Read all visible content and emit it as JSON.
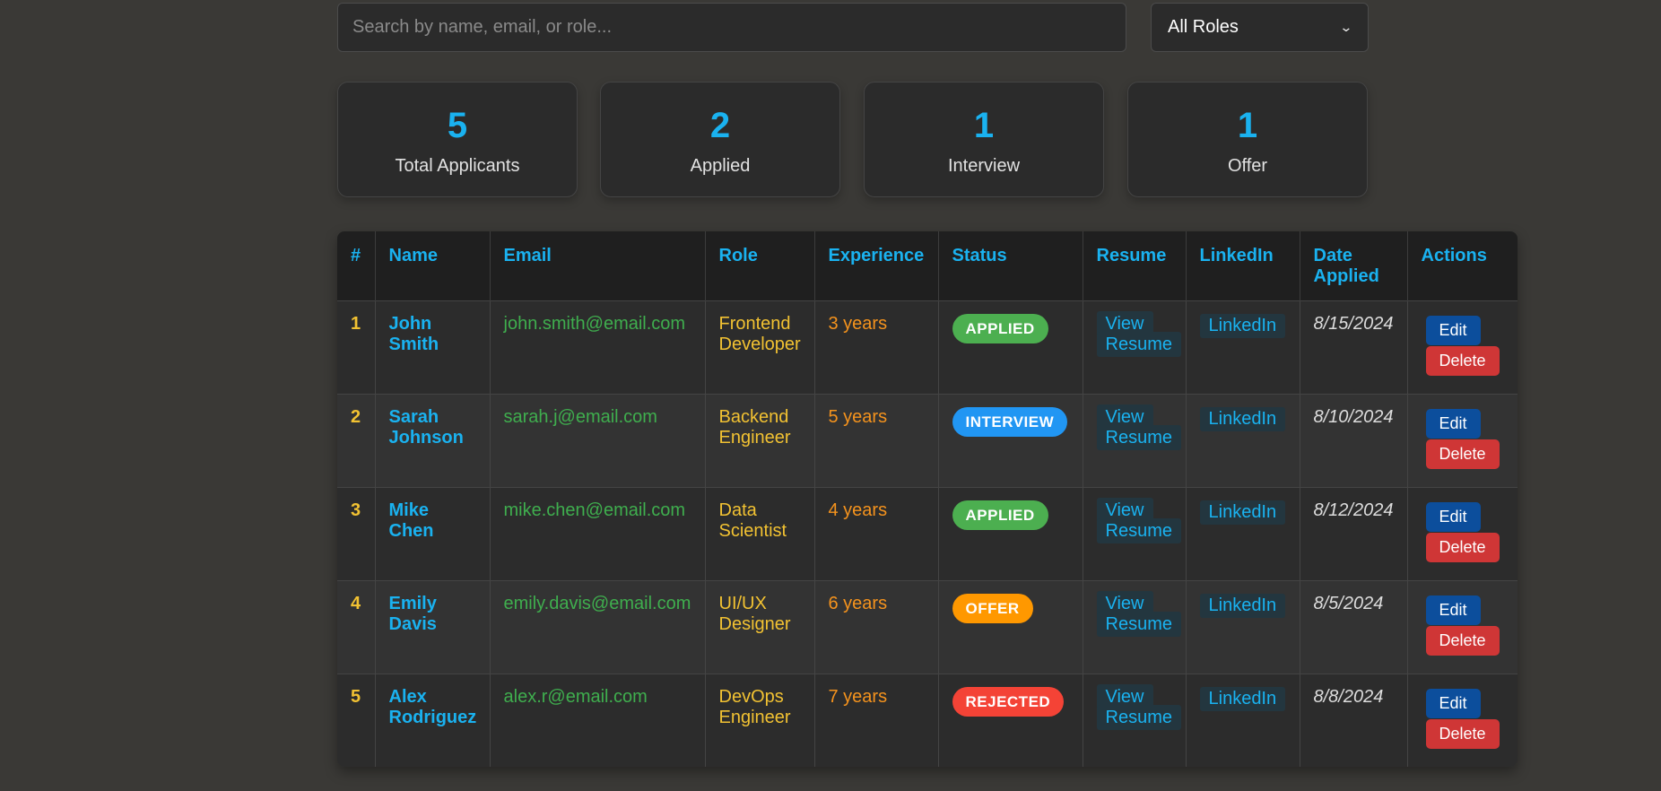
{
  "search": {
    "placeholder": "Search by name, email, or role..."
  },
  "role_filter": {
    "selected": "All Roles"
  },
  "stats": [
    {
      "value": "5",
      "label": "Total Applicants"
    },
    {
      "value": "2",
      "label": "Applied"
    },
    {
      "value": "1",
      "label": "Interview"
    },
    {
      "value": "1",
      "label": "Offer"
    }
  ],
  "table": {
    "headers": [
      "#",
      "Name",
      "Email",
      "Role",
      "Experience",
      "Status",
      "Resume",
      "LinkedIn",
      "Date Applied",
      "Actions"
    ],
    "rows": [
      {
        "num": "1",
        "name": "John Smith",
        "email": "john.smith@email.com",
        "role": "Frontend Developer",
        "experience": "3 years",
        "status": "APPLIED",
        "status_color": "#4caf50",
        "resume": "View Resume",
        "linkedin": "LinkedIn",
        "date": "8/15/2024",
        "edit": "Edit",
        "delete": "Delete"
      },
      {
        "num": "2",
        "name": "Sarah Johnson",
        "email": "sarah.j@email.com",
        "role": "Backend Engineer",
        "experience": "5 years",
        "status": "INTERVIEW",
        "status_color": "#2196f3",
        "resume": "View Resume",
        "linkedin": "LinkedIn",
        "date": "8/10/2024",
        "edit": "Edit",
        "delete": "Delete"
      },
      {
        "num": "3",
        "name": "Mike Chen",
        "email": "mike.chen@email.com",
        "role": "Data Scientist",
        "experience": "4 years",
        "status": "APPLIED",
        "status_color": "#4caf50",
        "resume": "View Resume",
        "linkedin": "LinkedIn",
        "date": "8/12/2024",
        "edit": "Edit",
        "delete": "Delete"
      },
      {
        "num": "4",
        "name": "Emily Davis",
        "email": "emily.davis@email.com",
        "role": "UI/UX Designer",
        "experience": "6 years",
        "status": "OFFER",
        "status_color": "#ff9800",
        "resume": "View Resume",
        "linkedin": "LinkedIn",
        "date": "8/5/2024",
        "edit": "Edit",
        "delete": "Delete"
      },
      {
        "num": "5",
        "name": "Alex Rodriguez",
        "email": "alex.r@email.com",
        "role": "DevOps Engineer",
        "experience": "7 years",
        "status": "REJECTED",
        "status_color": "#f44336",
        "resume": "View Resume",
        "linkedin": "LinkedIn",
        "date": "8/8/2024",
        "edit": "Edit",
        "delete": "Delete"
      }
    ]
  },
  "colors": {
    "accent": "#1ab2f0",
    "background": "#3a3936",
    "edit_button": "#0c4e9c",
    "delete_button": "#cf3636"
  }
}
